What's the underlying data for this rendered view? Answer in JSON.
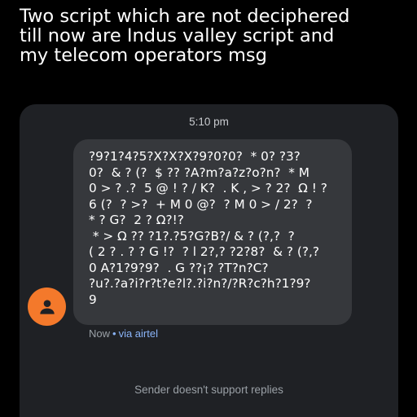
{
  "caption": {
    "lines": [
      "Two script which are not deciphered",
      "till now are Indus valley script and",
      "my telecom operators msg"
    ]
  },
  "thread": {
    "timestamp": "5:10 pm",
    "message": {
      "lines": [
        "?9?1?4?5?X?X?X?9?0?0?  * 0? ?3?",
        "0?  & ? (?  $ ?? ?A?m?a?z?o?n?  * M",
        "0 > ? .?  5 @ ! ? / K?  . K , > ? 2?  Ω ! ?",
        "6 (?  ? >?  + M 0 @?  ? M 0 > / 2?  ?",
        "* ? G?  2 ? Ω?!?",
        " * > Ω ?? ?1?.?5?G?B?/ & ? (?,?  ?",
        "( 2 ? . ? ? G !?  ? l 2?,? ?2?8?  & ? (?,?",
        "0 A?1?9?9?  . G ??¡? ?T?n?C?",
        "?u?.?a?i?r?t?e?l?.?i?n?/?R?c?h?1?9?",
        "9"
      ],
      "status": "Now",
      "separator": "•",
      "via": "via airtel"
    },
    "footer": "Sender doesn't support replies"
  },
  "icons": {
    "avatar": "person-icon"
  },
  "colors": {
    "background": "#000000",
    "panel": "#1f2125",
    "bubble": "#36383c",
    "avatar": "#f4792b",
    "link": "#8ab4f8"
  }
}
